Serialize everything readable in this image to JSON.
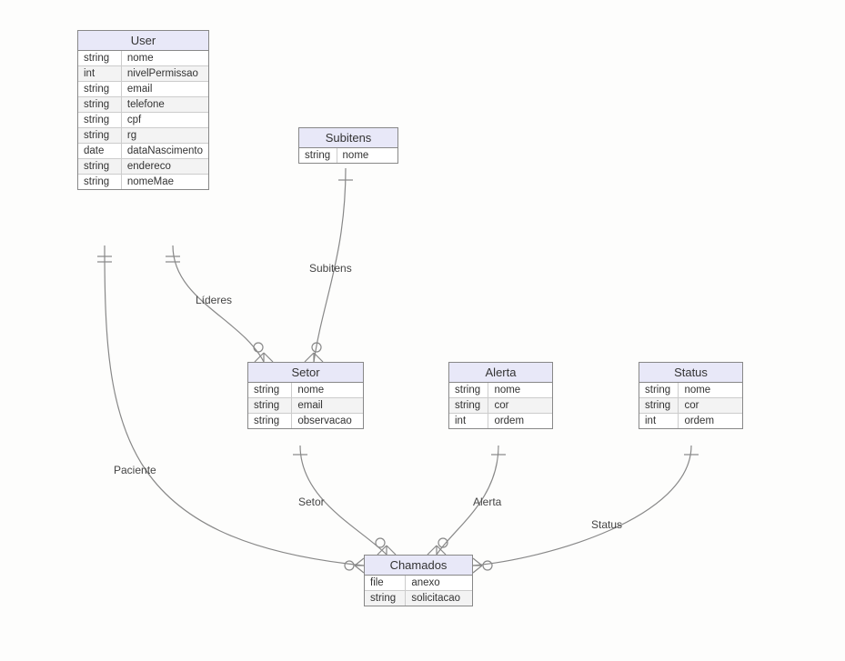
{
  "entities": {
    "user": {
      "name": "User",
      "attrs": [
        {
          "type": "string",
          "name": "nome"
        },
        {
          "type": "int",
          "name": "nivelPermissao"
        },
        {
          "type": "string",
          "name": "email"
        },
        {
          "type": "string",
          "name": "telefone"
        },
        {
          "type": "string",
          "name": "cpf"
        },
        {
          "type": "string",
          "name": "rg"
        },
        {
          "type": "date",
          "name": "dataNascimento"
        },
        {
          "type": "string",
          "name": "endereco"
        },
        {
          "type": "string",
          "name": "nomeMae"
        }
      ]
    },
    "subitens": {
      "name": "Subitens",
      "attrs": [
        {
          "type": "string",
          "name": "nome"
        }
      ]
    },
    "setor": {
      "name": "Setor",
      "attrs": [
        {
          "type": "string",
          "name": "nome"
        },
        {
          "type": "string",
          "name": "email"
        },
        {
          "type": "string",
          "name": "observacao"
        }
      ]
    },
    "alerta": {
      "name": "Alerta",
      "attrs": [
        {
          "type": "string",
          "name": "nome"
        },
        {
          "type": "string",
          "name": "cor"
        },
        {
          "type": "int",
          "name": "ordem"
        }
      ]
    },
    "status": {
      "name": "Status",
      "attrs": [
        {
          "type": "string",
          "name": "nome"
        },
        {
          "type": "string",
          "name": "cor"
        },
        {
          "type": "int",
          "name": "ordem"
        }
      ]
    },
    "chamados": {
      "name": "Chamados",
      "attrs": [
        {
          "type": "file",
          "name": "anexo"
        },
        {
          "type": "string",
          "name": "solicitacao"
        }
      ]
    }
  },
  "relations": {
    "lideres": "Líderes",
    "subitens": "Subitens",
    "paciente": "Paciente",
    "setor": "Setor",
    "alerta": "Alerta",
    "status": "Status"
  }
}
